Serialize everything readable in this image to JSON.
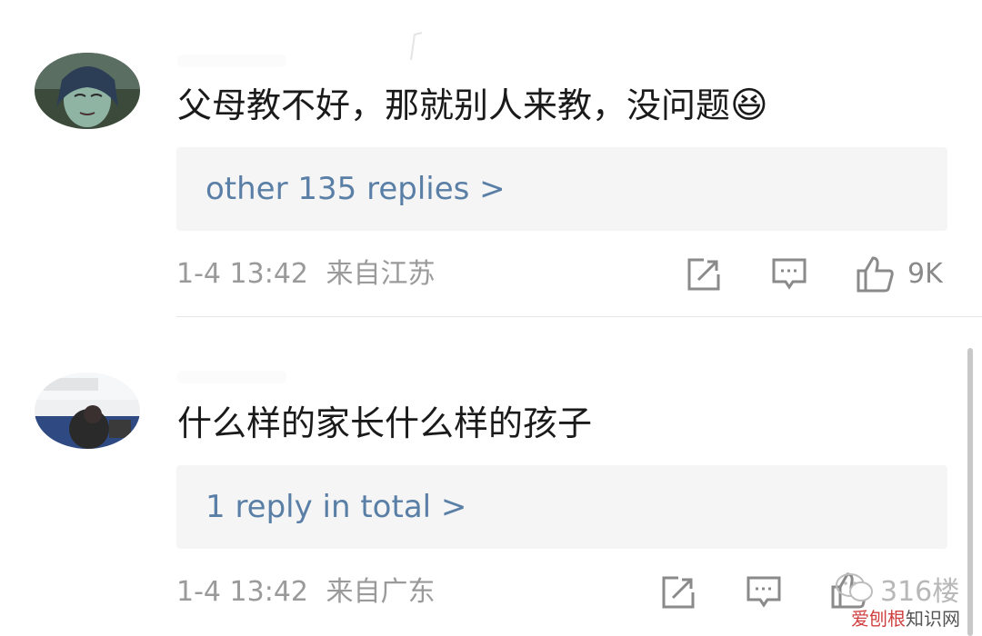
{
  "comments": [
    {
      "text": "父母教不好，那就别人来教，没问题",
      "emoji": "😆",
      "reply_link": "other 135 replies >",
      "timestamp": "1-4 13:42",
      "location": "来自江苏",
      "like_count": "9K"
    },
    {
      "text": "什么样的家长什么样的孩子",
      "reply_link": "1 reply in total >",
      "timestamp": "1-4 13:42",
      "location": "来自广东",
      "like_count": "316",
      "floor_label": "楼"
    }
  ],
  "icons": {
    "share": "share-icon",
    "comment": "comment-icon",
    "like": "thumbs-up-icon"
  },
  "watermark": {
    "brand": "爱刨根",
    "site": "知识网"
  },
  "colors": {
    "reply_link": "#5a7fa6",
    "meta_text": "#9a9a9a",
    "reply_box_bg": "#f5f5f5"
  }
}
